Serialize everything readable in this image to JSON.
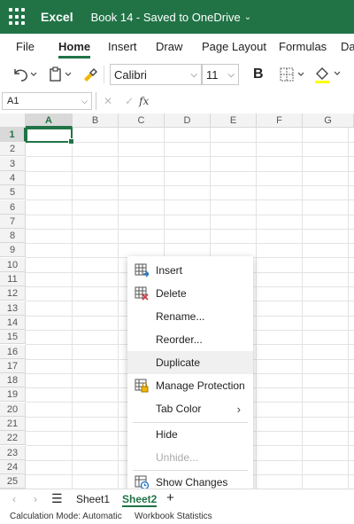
{
  "titlebar": {
    "app_name": "Excel",
    "doc_title": "Book 14 - Saved to OneDrive",
    "accent": "#217346"
  },
  "menu": {
    "tabs": [
      "File",
      "Home",
      "Insert",
      "Draw",
      "Page Layout",
      "Formulas",
      "Da"
    ],
    "active": "Home"
  },
  "toolbar": {
    "font_name": "Calibri",
    "font_size": "11",
    "bold": "B"
  },
  "formula_bar": {
    "name_box": "A1",
    "fx": "fx"
  },
  "grid": {
    "columns": [
      "A",
      "B",
      "C",
      "D",
      "E",
      "F",
      "G"
    ],
    "rows": [
      "1",
      "2",
      "3",
      "4",
      "5",
      "6",
      "7",
      "8",
      "9",
      "10",
      "11",
      "12",
      "13",
      "14",
      "15",
      "16",
      "17",
      "18",
      "19",
      "20",
      "21",
      "22",
      "23",
      "24",
      "25"
    ],
    "active_cell": "A1"
  },
  "context_menu": {
    "insert": "Insert",
    "delete": "Delete",
    "rename": "Rename...",
    "reorder": "Reorder...",
    "duplicate": "Duplicate",
    "manage_protection": "Manage Protection",
    "tab_color": "Tab Color",
    "hide": "Hide",
    "unhide": "Unhide...",
    "show_changes": "Show Changes"
  },
  "sheets": {
    "tabs": [
      "Sheet1",
      "Sheet2"
    ],
    "active": "Sheet2",
    "add": "+"
  },
  "status": {
    "calc_mode": "Calculation Mode: Automatic",
    "stats": "Workbook Statistics"
  }
}
